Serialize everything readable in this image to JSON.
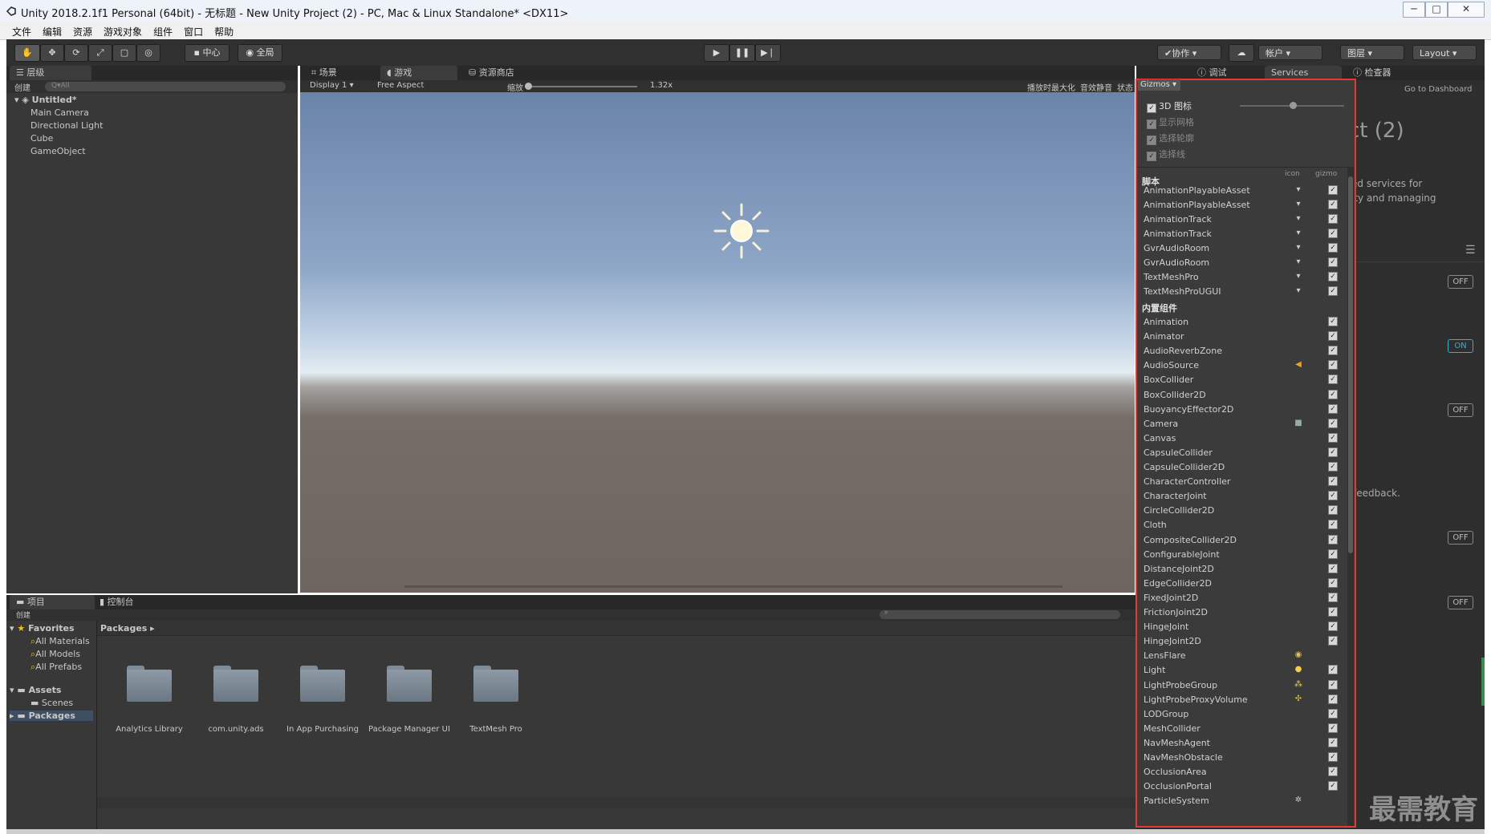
{
  "window": {
    "title": "Unity 2018.2.1f1 Personal (64bit) - 无标题 - New Unity Project (2) - PC, Mac & Linux Standalone* <DX11>",
    "buttons": [
      "─",
      "□",
      "✕"
    ]
  },
  "menu": [
    "文件",
    "编辑",
    "资源",
    "游戏对象",
    "组件",
    "窗口",
    "帮助"
  ],
  "toolbar": {
    "pivot": "中心",
    "global": "全局",
    "collab": "协作",
    "account": "帐户",
    "layers": "图层",
    "layout": "Layout"
  },
  "hierarchy": {
    "tab": "层级",
    "create": "创建",
    "search_placeholder": "Q▾All",
    "scene": "Untitled*",
    "items": [
      "Main Camera",
      "Directional Light",
      "Cube",
      "GameObject"
    ]
  },
  "center_tabs": [
    "场景",
    "游戏",
    "资源商店"
  ],
  "game_toolbar": {
    "display": "Display 1",
    "aspect": "Free Aspect",
    "scale_label": "缩放",
    "scale_value": "1.32x",
    "maximize": "播放时最大化",
    "mute": "音效静音",
    "stats": "状态",
    "gizmos": "Gizmos"
  },
  "right_tabs": {
    "debug": "调试",
    "services": "Services",
    "inspector": "检查器"
  },
  "services": {
    "dashboard": "Go to Dashboard",
    "title_fragment": "ct (2)",
    "desc_1": "ed services for",
    "desc_2": "ity and managing",
    "feedback": "feedback.",
    "toggles": [
      "OFF",
      "ON",
      "OFF",
      "OFF",
      "OFF"
    ]
  },
  "gizmos_panel": {
    "top_options": [
      "3D 图标",
      "显示网格",
      "选择轮廓",
      "选择线"
    ],
    "scripts_header": "脚本",
    "col_icon": "icon",
    "col_gizmo": "gizmo",
    "scripts": [
      "AnimationPlayableAsset",
      "AnimationPlayableAsset",
      "AnimationTrack",
      "AnimationTrack",
      "GvrAudioRoom",
      "GvrAudioRoom",
      "TextMeshPro",
      "TextMeshProUGUI"
    ],
    "builtin_header": "内置组件",
    "builtin": [
      {
        "name": "Animation",
        "icon": ""
      },
      {
        "name": "Animator",
        "icon": ""
      },
      {
        "name": "AudioReverbZone",
        "icon": ""
      },
      {
        "name": "AudioSource",
        "icon": "speaker-icon"
      },
      {
        "name": "BoxCollider",
        "icon": ""
      },
      {
        "name": "BoxCollider2D",
        "icon": ""
      },
      {
        "name": "BuoyancyEffector2D",
        "icon": ""
      },
      {
        "name": "Camera",
        "icon": "camera-icon"
      },
      {
        "name": "Canvas",
        "icon": ""
      },
      {
        "name": "CapsuleCollider",
        "icon": ""
      },
      {
        "name": "CapsuleCollider2D",
        "icon": ""
      },
      {
        "name": "CharacterController",
        "icon": ""
      },
      {
        "name": "CharacterJoint",
        "icon": ""
      },
      {
        "name": "CircleCollider2D",
        "icon": ""
      },
      {
        "name": "Cloth",
        "icon": ""
      },
      {
        "name": "CompositeCollider2D",
        "icon": ""
      },
      {
        "name": "ConfigurableJoint",
        "icon": ""
      },
      {
        "name": "DistanceJoint2D",
        "icon": ""
      },
      {
        "name": "EdgeCollider2D",
        "icon": ""
      },
      {
        "name": "FixedJoint2D",
        "icon": ""
      },
      {
        "name": "FrictionJoint2D",
        "icon": ""
      },
      {
        "name": "HingeJoint",
        "icon": ""
      },
      {
        "name": "HingeJoint2D",
        "icon": ""
      },
      {
        "name": "LensFlare",
        "icon": "lensflare-icon"
      },
      {
        "name": "Light",
        "icon": "bulb-icon"
      },
      {
        "name": "LightProbeGroup",
        "icon": "probe-icon"
      },
      {
        "name": "LightProbeProxyVolume",
        "icon": "probe-volume-icon"
      },
      {
        "name": "LODGroup",
        "icon": ""
      },
      {
        "name": "MeshCollider",
        "icon": ""
      },
      {
        "name": "NavMeshAgent",
        "icon": ""
      },
      {
        "name": "NavMeshObstacle",
        "icon": ""
      },
      {
        "name": "OcclusionArea",
        "icon": ""
      },
      {
        "name": "OcclusionPortal",
        "icon": ""
      },
      {
        "name": "ParticleSystem",
        "icon": "particle-icon"
      }
    ]
  },
  "project": {
    "tabs": [
      "项目",
      "控制台"
    ],
    "create": "创建",
    "favorites": "Favorites",
    "fav_items": [
      "All Materials",
      "All Models",
      "All Prefabs"
    ],
    "assets": "Assets",
    "scenes": "Scenes",
    "packages": "Packages",
    "breadcrumb": "Packages",
    "folders": [
      "Analytics Library",
      "com.unity.ads",
      "In App Purchasing",
      "Package Manager UI",
      "TextMesh Pro"
    ]
  },
  "watermark": "最需教育",
  "colors": {
    "highlight_border": "#e53935",
    "on_toggle": "#2bb3d6"
  }
}
